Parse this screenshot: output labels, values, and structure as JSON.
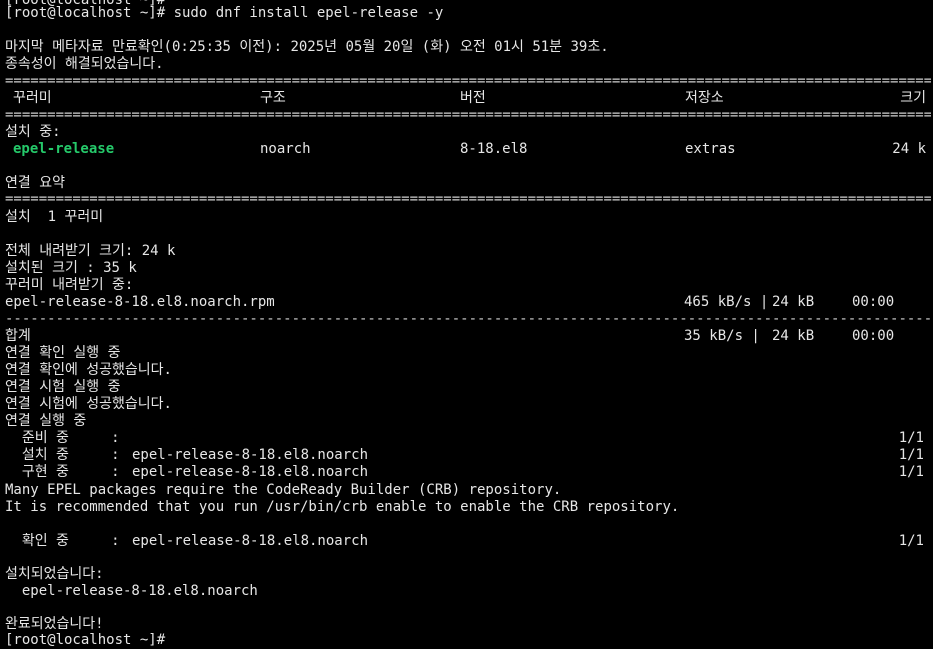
{
  "prompt1": "[root@localhost ~]# ",
  "command": "sudo dnf install epel-release -y",
  "meta_line": "마지막 메타자료 만료확인(0:25:35 이전): 2025년 05월 20일 (화) 오전 01시 51분 39초.",
  "deps_resolved": "종속성이 해결되었습니다.",
  "separator_double": "==================================================================================================================================================================",
  "separator_single": "------------------------------------------------------------------------------------------------------------------------------------------------------------------",
  "table_header": {
    "package": "꾸러미",
    "arch": "구조",
    "version": "버전",
    "repo": "저장소",
    "size": "크기"
  },
  "installing_label": "설치 중:",
  "package_row": {
    "name": "epel-release",
    "arch": "noarch",
    "version": "8-18.el8",
    "repo": "extras",
    "size": "24 k"
  },
  "summary_title": "연결 요약",
  "install_count": "설치  1 꾸러미",
  "total_download": "전체 내려받기 크기: 24 k",
  "installed_size": "설치된 크기 : 35 k",
  "downloading": "꾸러미 내려받기 중:",
  "download_row": {
    "file": "epel-release-8-18.el8.noarch.rpm",
    "speed": "465 kB/s |",
    "size": "24 kB",
    "time": "00:00"
  },
  "total_row": {
    "label": "합계",
    "speed": "35 kB/s |",
    "size": "24 kB",
    "time": "00:00"
  },
  "tx_lines": [
    "연결 확인 실행 중",
    "연결 확인에 성공했습니다.",
    "연결 시험 실행 중",
    "연결 시험에 성공했습니다.",
    "연결 실행 중"
  ],
  "steps": [
    {
      "label": "  준비 중     :",
      "value": "",
      "progress": "1/1"
    },
    {
      "label": "  설치 중     :",
      "value": "epel-release-8-18.el8.noarch",
      "progress": "1/1"
    },
    {
      "label": "  구현 중     :",
      "value": "epel-release-8-18.el8.noarch",
      "progress": "1/1"
    }
  ],
  "epel_note1": "Many EPEL packages require the CodeReady Builder (CRB) repository.",
  "epel_note2": "It is recommended that you run /usr/bin/crb enable to enable the CRB repository.",
  "verify_step": {
    "label": "  확인 중     :",
    "value": "epel-release-8-18.el8.noarch",
    "progress": "1/1"
  },
  "installed_label": "설치되었습니다:",
  "installed_pkg": "  epel-release-8-18.el8.noarch",
  "complete": "완료되었습니다!",
  "prompt2": "[root@localhost ~]# "
}
